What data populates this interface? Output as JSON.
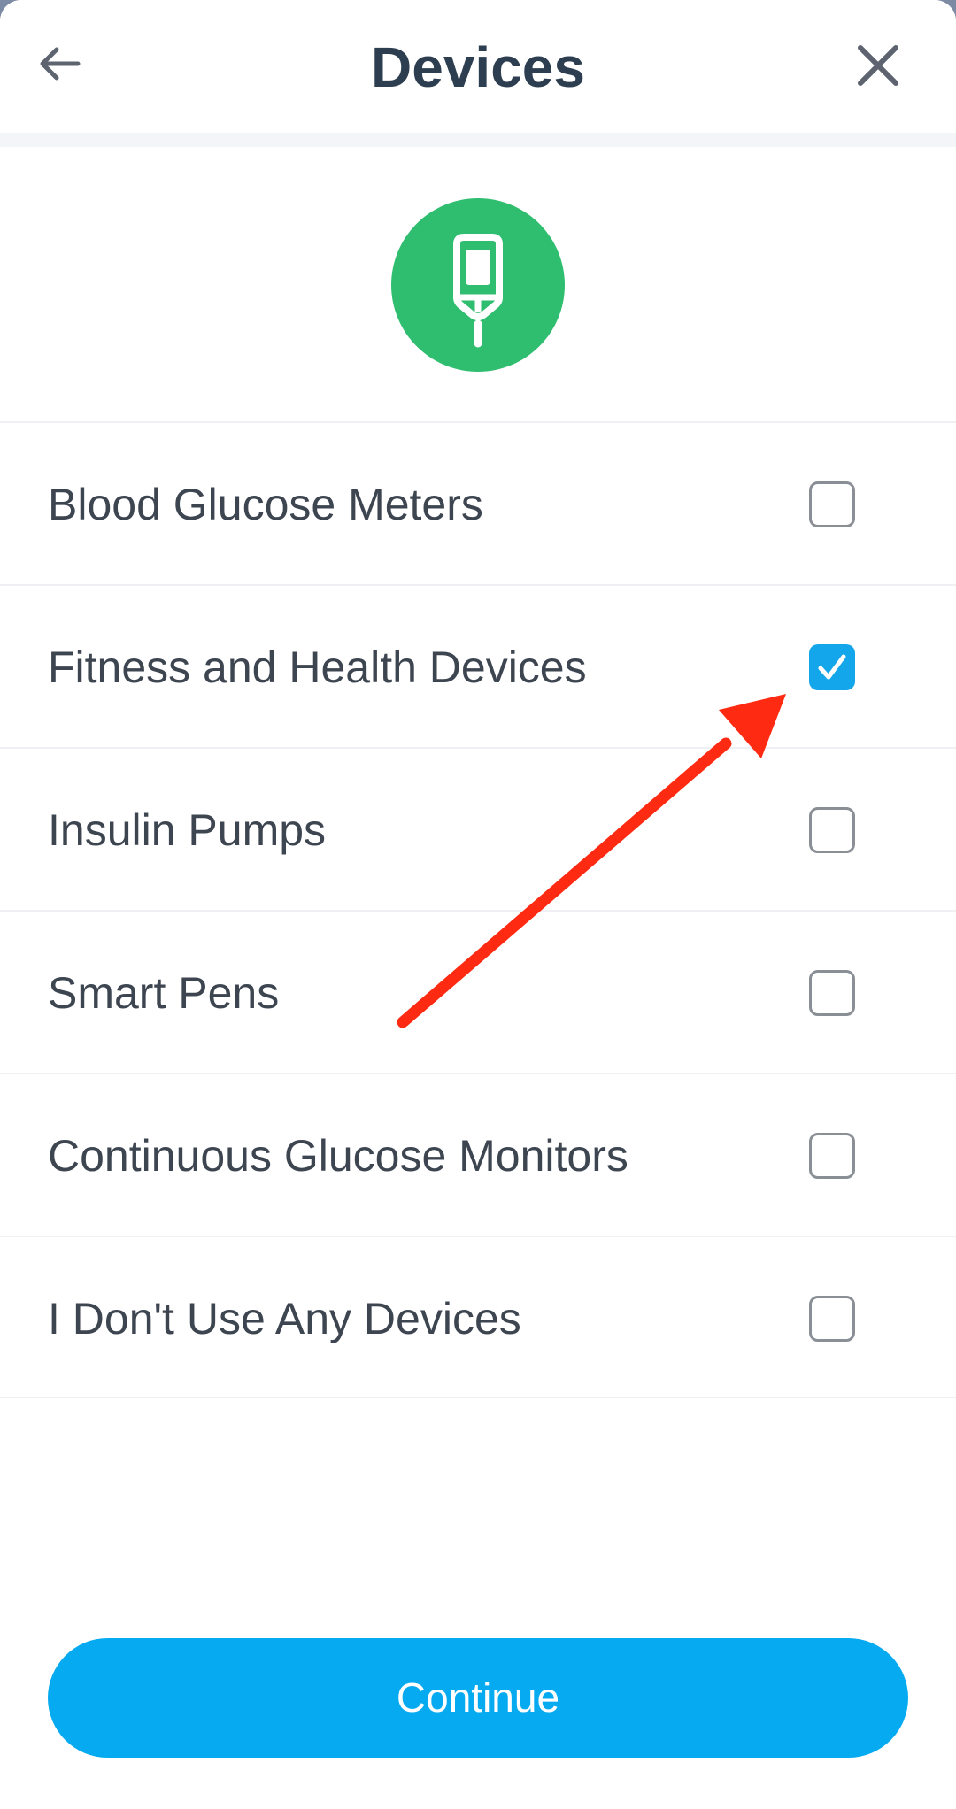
{
  "header": {
    "title": "Devices",
    "back_icon": "arrow-left-icon",
    "close_icon": "close-icon"
  },
  "hero": {
    "icon": "glucose-meter-icon",
    "icon_bg_color": "#2fbe6f"
  },
  "options": [
    {
      "label": "Blood Glucose Meters",
      "checked": false
    },
    {
      "label": "Fitness and Health Devices",
      "checked": true
    },
    {
      "label": "Insulin Pumps",
      "checked": false
    },
    {
      "label": "Smart Pens",
      "checked": false
    },
    {
      "label": "Continuous Glucose Monitors",
      "checked": false
    },
    {
      "label": "I Don't Use Any Devices",
      "checked": false
    }
  ],
  "continue_label": "Continue",
  "colors": {
    "accent": "#05aaf0",
    "checkbox_checked": "#13a6ea",
    "annotation_arrow": "#ff2a12",
    "title_text": "#2c3e50"
  }
}
